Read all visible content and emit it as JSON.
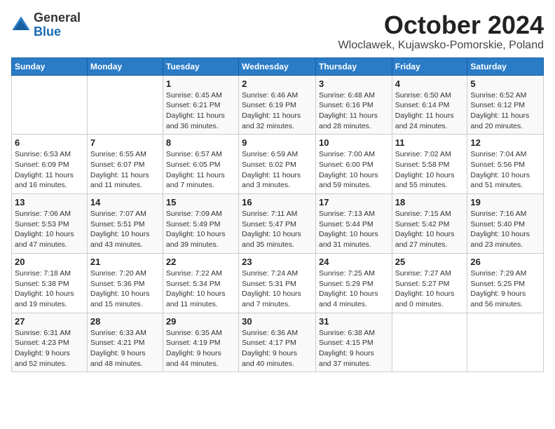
{
  "header": {
    "logo_general": "General",
    "logo_blue": "Blue",
    "title": "October 2024",
    "location": "Wloclawek, Kujawsko-Pomorskie, Poland"
  },
  "days_of_week": [
    "Sunday",
    "Monday",
    "Tuesday",
    "Wednesday",
    "Thursday",
    "Friday",
    "Saturday"
  ],
  "weeks": [
    [
      {
        "day": "",
        "info": ""
      },
      {
        "day": "",
        "info": ""
      },
      {
        "day": "1",
        "info": "Sunrise: 6:45 AM\nSunset: 6:21 PM\nDaylight: 11 hours\nand 36 minutes."
      },
      {
        "day": "2",
        "info": "Sunrise: 6:46 AM\nSunset: 6:19 PM\nDaylight: 11 hours\nand 32 minutes."
      },
      {
        "day": "3",
        "info": "Sunrise: 6:48 AM\nSunset: 6:16 PM\nDaylight: 11 hours\nand 28 minutes."
      },
      {
        "day": "4",
        "info": "Sunrise: 6:50 AM\nSunset: 6:14 PM\nDaylight: 11 hours\nand 24 minutes."
      },
      {
        "day": "5",
        "info": "Sunrise: 6:52 AM\nSunset: 6:12 PM\nDaylight: 11 hours\nand 20 minutes."
      }
    ],
    [
      {
        "day": "6",
        "info": "Sunrise: 6:53 AM\nSunset: 6:09 PM\nDaylight: 11 hours\nand 16 minutes."
      },
      {
        "day": "7",
        "info": "Sunrise: 6:55 AM\nSunset: 6:07 PM\nDaylight: 11 hours\nand 11 minutes."
      },
      {
        "day": "8",
        "info": "Sunrise: 6:57 AM\nSunset: 6:05 PM\nDaylight: 11 hours\nand 7 minutes."
      },
      {
        "day": "9",
        "info": "Sunrise: 6:59 AM\nSunset: 6:02 PM\nDaylight: 11 hours\nand 3 minutes."
      },
      {
        "day": "10",
        "info": "Sunrise: 7:00 AM\nSunset: 6:00 PM\nDaylight: 10 hours\nand 59 minutes."
      },
      {
        "day": "11",
        "info": "Sunrise: 7:02 AM\nSunset: 5:58 PM\nDaylight: 10 hours\nand 55 minutes."
      },
      {
        "day": "12",
        "info": "Sunrise: 7:04 AM\nSunset: 5:56 PM\nDaylight: 10 hours\nand 51 minutes."
      }
    ],
    [
      {
        "day": "13",
        "info": "Sunrise: 7:06 AM\nSunset: 5:53 PM\nDaylight: 10 hours\nand 47 minutes."
      },
      {
        "day": "14",
        "info": "Sunrise: 7:07 AM\nSunset: 5:51 PM\nDaylight: 10 hours\nand 43 minutes."
      },
      {
        "day": "15",
        "info": "Sunrise: 7:09 AM\nSunset: 5:49 PM\nDaylight: 10 hours\nand 39 minutes."
      },
      {
        "day": "16",
        "info": "Sunrise: 7:11 AM\nSunset: 5:47 PM\nDaylight: 10 hours\nand 35 minutes."
      },
      {
        "day": "17",
        "info": "Sunrise: 7:13 AM\nSunset: 5:44 PM\nDaylight: 10 hours\nand 31 minutes."
      },
      {
        "day": "18",
        "info": "Sunrise: 7:15 AM\nSunset: 5:42 PM\nDaylight: 10 hours\nand 27 minutes."
      },
      {
        "day": "19",
        "info": "Sunrise: 7:16 AM\nSunset: 5:40 PM\nDaylight: 10 hours\nand 23 minutes."
      }
    ],
    [
      {
        "day": "20",
        "info": "Sunrise: 7:18 AM\nSunset: 5:38 PM\nDaylight: 10 hours\nand 19 minutes."
      },
      {
        "day": "21",
        "info": "Sunrise: 7:20 AM\nSunset: 5:36 PM\nDaylight: 10 hours\nand 15 minutes."
      },
      {
        "day": "22",
        "info": "Sunrise: 7:22 AM\nSunset: 5:34 PM\nDaylight: 10 hours\nand 11 minutes."
      },
      {
        "day": "23",
        "info": "Sunrise: 7:24 AM\nSunset: 5:31 PM\nDaylight: 10 hours\nand 7 minutes."
      },
      {
        "day": "24",
        "info": "Sunrise: 7:25 AM\nSunset: 5:29 PM\nDaylight: 10 hours\nand 4 minutes."
      },
      {
        "day": "25",
        "info": "Sunrise: 7:27 AM\nSunset: 5:27 PM\nDaylight: 10 hours\nand 0 minutes."
      },
      {
        "day": "26",
        "info": "Sunrise: 7:29 AM\nSunset: 5:25 PM\nDaylight: 9 hours\nand 56 minutes."
      }
    ],
    [
      {
        "day": "27",
        "info": "Sunrise: 6:31 AM\nSunset: 4:23 PM\nDaylight: 9 hours\nand 52 minutes."
      },
      {
        "day": "28",
        "info": "Sunrise: 6:33 AM\nSunset: 4:21 PM\nDaylight: 9 hours\nand 48 minutes."
      },
      {
        "day": "29",
        "info": "Sunrise: 6:35 AM\nSunset: 4:19 PM\nDaylight: 9 hours\nand 44 minutes."
      },
      {
        "day": "30",
        "info": "Sunrise: 6:36 AM\nSunset: 4:17 PM\nDaylight: 9 hours\nand 40 minutes."
      },
      {
        "day": "31",
        "info": "Sunrise: 6:38 AM\nSunset: 4:15 PM\nDaylight: 9 hours\nand 37 minutes."
      },
      {
        "day": "",
        "info": ""
      },
      {
        "day": "",
        "info": ""
      }
    ]
  ]
}
